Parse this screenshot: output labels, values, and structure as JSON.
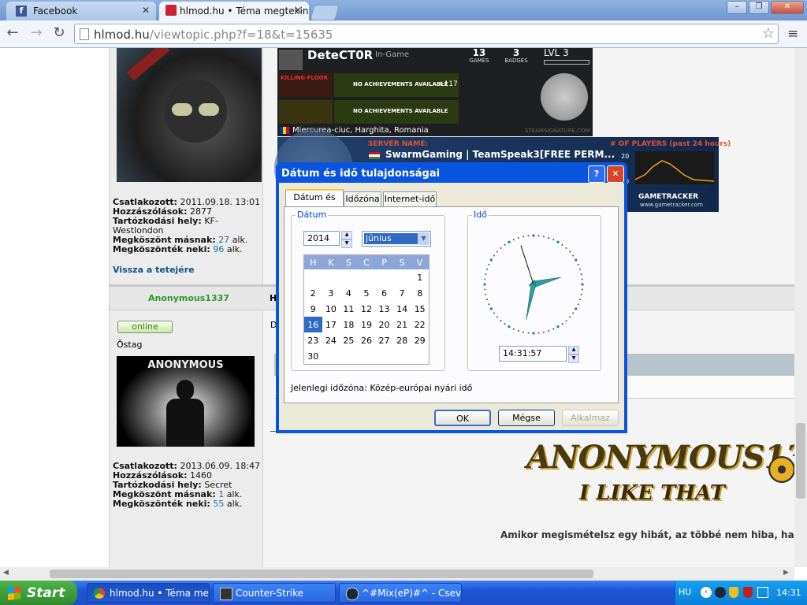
{
  "browser": {
    "tabs": [
      {
        "title": "Facebook"
      },
      {
        "title": "hlmod.hu • Téma megtekinté"
      }
    ],
    "url_host": "hlmod.hu",
    "url_path": "/viewtopic.php?f=18&t=15635",
    "window_controls": {
      "minimize": "–",
      "restore": "❐",
      "close": "✕"
    }
  },
  "steam_sig": {
    "name": "DeteCT0R",
    "status": "In-Game",
    "games_count": "13",
    "games_label": "GAMES",
    "badges_count": "3",
    "badges_label": "BADGES",
    "level": "LVL 3",
    "game1_name": "KILLING FLOOR",
    "game1_text": "NO ACHIEVEMENTS AVAILABLE",
    "game1_extra": "+117",
    "game2_text": "NO ACHIEVEMENTS AVAILABLE",
    "location": "Miercurea-ciuc, Harghita, Romania",
    "footer": "STEAMSIGNATURE.COM"
  },
  "tracker": {
    "server_label": "SERVER NAME:",
    "server_name": "SwarmGaming | TeamSpeak3[FREE PERM...",
    "players_label": "# OF PLAYERS (past 24 hours)",
    "axis_top": "20",
    "axis_bottom": "0",
    "brand": "GAMETRACKER",
    "brand_url": "www.gametracker.com"
  },
  "post1": {
    "joined_label": "Csatlakozott:",
    "joined_value": "2011.09.18. 13:01",
    "posts_label": "Hozzászólások:",
    "posts_value": "2877",
    "location_label": "Tartózkodási hely:",
    "location_value": "KF-Westlondon",
    "thanked_label": "Megköszönt másnak:",
    "thanked_value": "27",
    "thanks_label": "Megköszönték neki:",
    "thanks_value": "96",
    "times": "alk.",
    "back_to_top": "Vissza a tetejére"
  },
  "post2": {
    "author": "Anonymous1337",
    "header_initial": "H",
    "online": "online",
    "rank": "Őstag",
    "avatar_text": "ANONYMOUS",
    "body_initial": "D",
    "joined_label": "Csatlakozott:",
    "joined_value": "2013.06.09. 18:47",
    "posts_label": "Hozzászólások:",
    "posts_value": "1460",
    "location_label": "Tartózkodási hely:",
    "location_value": "Secret",
    "thanked_label": "Megköszönt másnak:",
    "thanked_value": "1",
    "thanks_label": "Megköszönték neki:",
    "thanks_value": "55",
    "times": "alk.",
    "sig_title": "ANONYMOUS1337",
    "sig_sub": "I LIKE THAT",
    "sig_quote": "Amikor megismételsz egy hibát, az többé nem hiba, hanem d"
  },
  "dialog": {
    "title": "Dátum és idő tulajdonságai",
    "help": "?",
    "close": "✕",
    "tabs": [
      "Dátum és idő",
      "Időzóna",
      "Internet-idő"
    ],
    "date_group": "Dátum",
    "year": "2014",
    "month": "június",
    "weekdays": [
      "H",
      "K",
      "Sz",
      "Cs",
      "P",
      "Sz",
      "V"
    ],
    "weekday_display": [
      "H",
      "K",
      "S",
      "C",
      "P",
      "S",
      "V"
    ],
    "calendar_weeks": [
      [
        "",
        "",
        "",
        "",
        "",
        "",
        "1"
      ],
      [
        "2",
        "3",
        "4",
        "5",
        "6",
        "7",
        "8"
      ],
      [
        "9",
        "10",
        "11",
        "12",
        "13",
        "14",
        "15"
      ],
      [
        "16",
        "17",
        "18",
        "19",
        "20",
        "21",
        "22"
      ],
      [
        "23",
        "24",
        "25",
        "26",
        "27",
        "28",
        "29"
      ],
      [
        "30",
        "",
        "",
        "",
        "",
        "",
        ""
      ]
    ],
    "selected_day": "16",
    "time_group": "Idő",
    "time": "14:31:57",
    "clock": {
      "hour": 14,
      "minute": 31,
      "second": 57
    },
    "timezone_text": "Jelenlegi időzóna: Közép-európai nyári idő",
    "ok": "OK",
    "cancel": "Mégse",
    "apply": "Alkalmaz"
  },
  "taskbar": {
    "start": "Start",
    "items": [
      "hlmod.hu • Téma megt...",
      "Counter-Strike",
      "^#Mix(eP)#^ - Csev..."
    ],
    "lang": "HU",
    "clock": "14:31"
  }
}
